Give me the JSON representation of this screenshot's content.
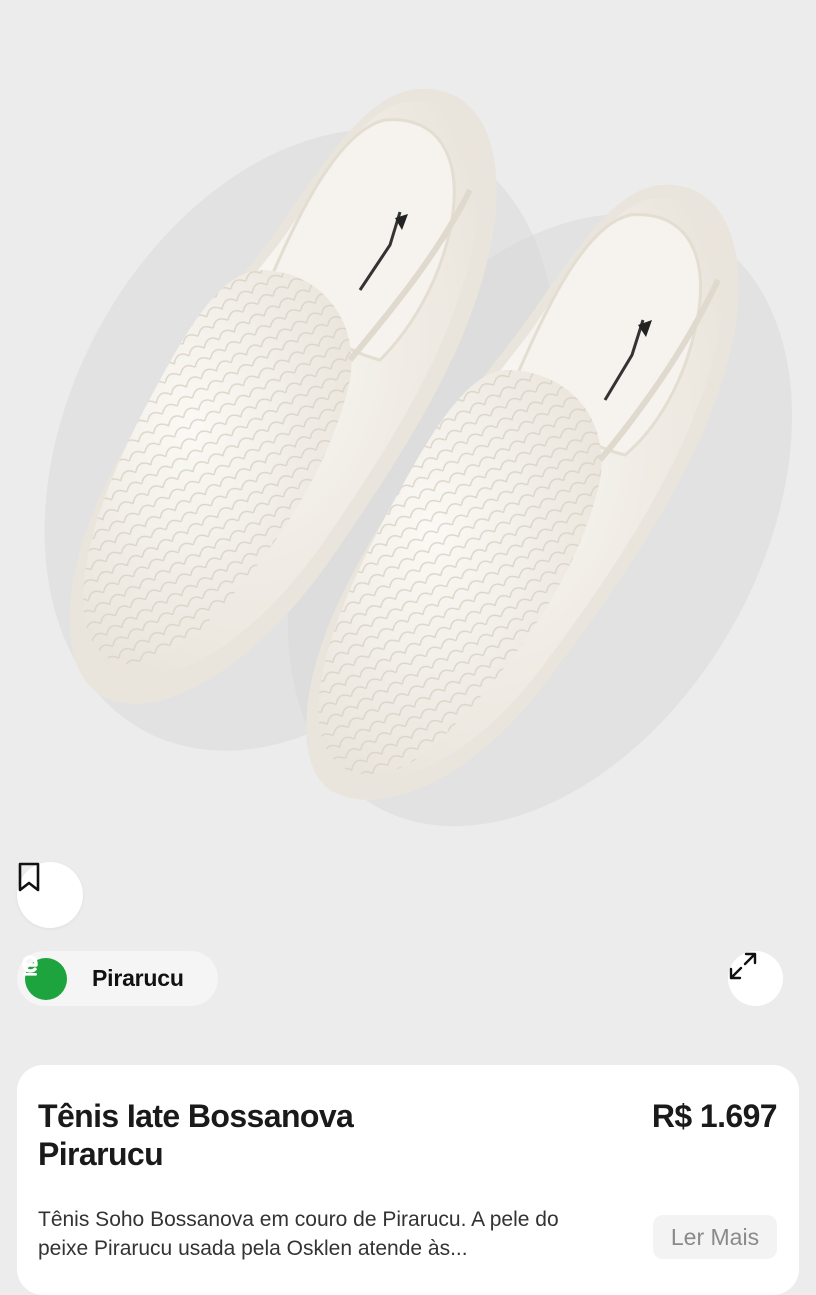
{
  "image": {
    "alt": "Tênis Iate Bossanova Pirarucu",
    "insole_brand": "OSKLEN"
  },
  "actions": {
    "bookmark_icon": "bookmark-icon",
    "expand_icon": "expand-icon"
  },
  "source": {
    "logo_letter": "e",
    "name": "Pirarucu"
  },
  "product": {
    "title": "Tênis Iate Bossanova Pirarucu",
    "price": "R$ 1.697",
    "description": "Tênis Soho Bossanova em couro de Pirarucu. A pele do peixe Pirarucu usada pela Osklen atende às...",
    "read_more_label": "Ler Mais"
  },
  "colors": {
    "background": "#ececec",
    "card": "#ffffff",
    "logo_green": "#1ea43f",
    "shoe": "#f1ede6"
  }
}
